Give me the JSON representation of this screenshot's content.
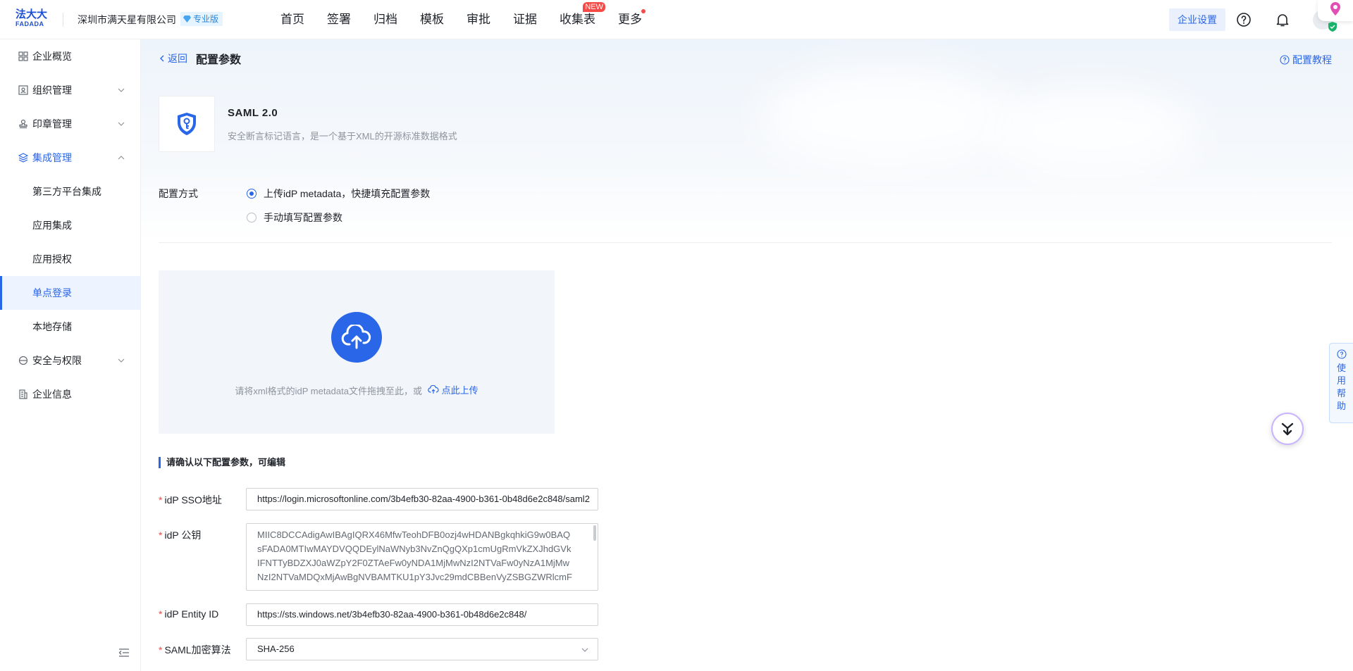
{
  "header": {
    "logo_cn": "法大大",
    "logo_en": "FADADA",
    "company_name": "深圳市满天星有限公司",
    "edition": "专业版",
    "nav": [
      {
        "label": "首页"
      },
      {
        "label": "签署"
      },
      {
        "label": "归档"
      },
      {
        "label": "模板"
      },
      {
        "label": "审批"
      },
      {
        "label": "证据"
      },
      {
        "label": "收集表",
        "badge": "NEW"
      },
      {
        "label": "更多",
        "dot": true
      }
    ],
    "enterprise_settings": "企业设置"
  },
  "sidebar": {
    "items": [
      {
        "label": "企业概览",
        "icon": "dashboard-icon"
      },
      {
        "label": "组织管理",
        "icon": "org-icon",
        "expandable": true
      },
      {
        "label": "印章管理",
        "icon": "seal-icon",
        "expandable": true
      },
      {
        "label": "集成管理",
        "icon": "layers-icon",
        "expanded": true
      },
      {
        "label": "安全与权限",
        "icon": "shield-icon",
        "expandable": true
      },
      {
        "label": "企业信息",
        "icon": "building-icon"
      }
    ],
    "sub_items": [
      {
        "label": "第三方平台集成"
      },
      {
        "label": "应用集成"
      },
      {
        "label": "应用授权"
      },
      {
        "label": "单点登录",
        "selected": true
      },
      {
        "label": "本地存储"
      }
    ]
  },
  "page": {
    "back": "返回",
    "title": "配置参数",
    "tutorial": "配置教程",
    "protocol_name": "SAML 2.0",
    "protocol_desc": "安全断言标记语言，是一个基于XML的开源标准数据格式",
    "config_method_label": "配置方式",
    "options": [
      {
        "label": "上传idP metadata，快捷填充配置参数",
        "checked": true
      },
      {
        "label": "手动填写配置参数",
        "checked": false
      }
    ],
    "upload_hint": "请将xml格式的idP metadata文件拖拽至此，或",
    "upload_link": "点此上传",
    "section_title": "请确认以下配置参数，可编辑",
    "fields": {
      "sso_url_label": "idP SSO地址",
      "sso_url_value": "https://login.microsoftonline.com/3b4efb30-82aa-4900-b361-0b48d6e2c848/saml2",
      "public_key_label": "idP 公钥",
      "public_key_lines": [
        "MIIC8DCCAdigAwIBAgIQRX46MfwTeohDFB0ozj4wHDANBgkqhkiG9w0BAQ",
        "sFADA0MTIwMAYDVQQDEylNaWNyb3NvZnQgQXp1cmUgRmVkZXJhdGVk",
        "IFNTTyBDZXJ0aWZpY2F0ZTAeFw0yNDA1MjMwNzI2NTVaFw0yNzA1MjMw",
        "NzI2NTVaMDQxMjAwBgNVBAMTKU1pY3Jvc29mdCBBenVyZSBGZWRlcmF"
      ],
      "entity_id_label": "idP Entity ID",
      "entity_id_value": "https://sts.windows.net/3b4efb30-82aa-4900-b361-0b48d6e2c848/",
      "algorithm_label": "SAML加密算法",
      "algorithm_value": "SHA-256"
    },
    "help_tab": [
      "使",
      "用",
      "帮",
      "助"
    ]
  },
  "colors": {
    "primary": "#2a66e8",
    "required": "#f54a45"
  }
}
